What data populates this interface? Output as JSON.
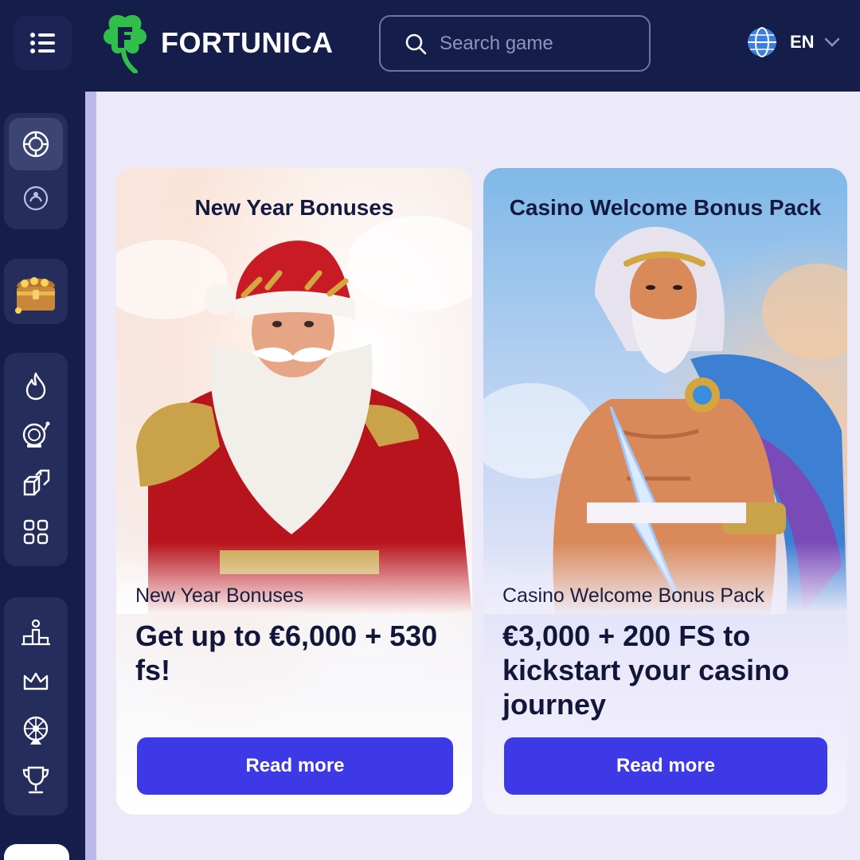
{
  "header": {
    "brand": "FORTUNICA",
    "search_placeholder": "Search game",
    "language": "EN"
  },
  "sidebar": {
    "groups": [
      {
        "items": [
          {
            "icon": "casino-chip-icon",
            "active": true
          },
          {
            "icon": "live-casino-icon",
            "active": false
          }
        ]
      },
      {
        "items": [
          {
            "icon": "treasure-chest-icon",
            "active": false
          }
        ]
      },
      {
        "items": [
          {
            "icon": "fire-icon"
          },
          {
            "icon": "slot-machine-icon"
          },
          {
            "icon": "cubes-icon"
          },
          {
            "icon": "grid-icon"
          }
        ]
      },
      {
        "items": [
          {
            "icon": "podium-icon"
          },
          {
            "icon": "crown-icon"
          },
          {
            "icon": "wheel-icon"
          },
          {
            "icon": "trophy-icon"
          }
        ]
      }
    ]
  },
  "promos": [
    {
      "top_title": "New Year Bonuses",
      "subtitle": "New Year Bonuses",
      "headline": "Get up to €6,000 + 530 fs!",
      "button": "Read more"
    },
    {
      "top_title": "Casino Welcome Bonus Pack",
      "subtitle": "Casino Welcome Bonus Pack",
      "headline": "€3,000 + 200 FS to kickstart your casino journey",
      "button": "Read more"
    }
  ],
  "colors": {
    "header_bg": "#151d4a",
    "accent_button": "#3d39e6",
    "logo_green": "#2fbf4a",
    "page_bg": "#eceaf8"
  }
}
